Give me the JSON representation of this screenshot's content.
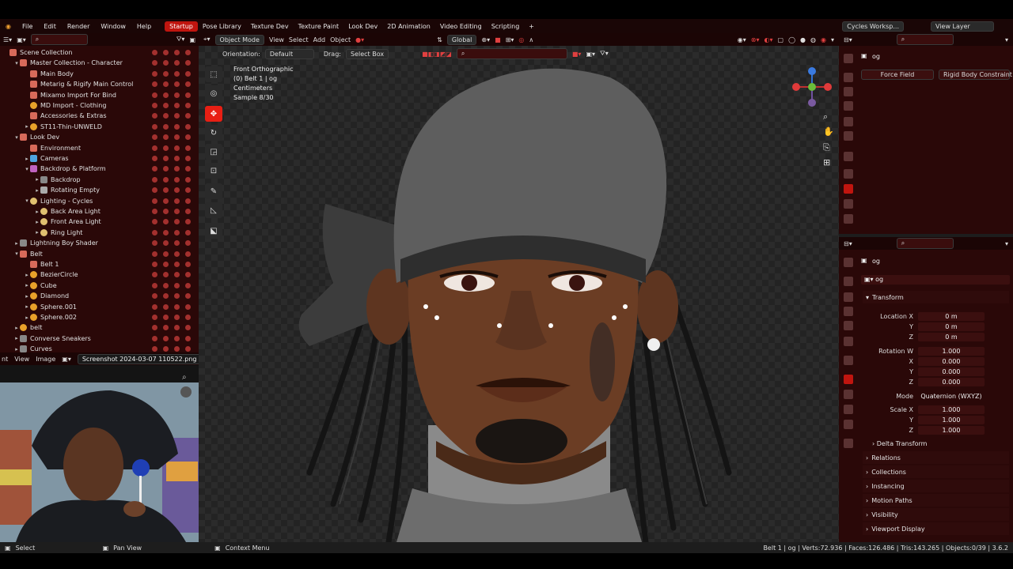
{
  "topbar": {
    "menu": [
      "File",
      "Edit",
      "Render",
      "Window",
      "Help"
    ],
    "workspaces": [
      "Startup",
      "Pose Library",
      "Texture Dev",
      "Texture Paint",
      "Look Dev",
      "2D Animation",
      "Video Editing",
      "Scripting"
    ],
    "add_tab": "+",
    "scene": "Cycles Worksp...",
    "view_layer": "View Layer"
  },
  "outliner": {
    "rows": [
      {
        "label": "Scene Collection",
        "icon": "col",
        "indent": 0,
        "twist": ""
      },
      {
        "label": "Master Collection - Character",
        "icon": "col",
        "indent": 1,
        "twist": "▾"
      },
      {
        "label": "Main Body",
        "icon": "col",
        "indent": 2,
        "twist": ""
      },
      {
        "label": "Metarig & Rigify Main Control",
        "icon": "col",
        "indent": 2,
        "twist": ""
      },
      {
        "label": "Mixamo Import For Bind",
        "icon": "col",
        "indent": 2,
        "twist": ""
      },
      {
        "label": "MD Import - Clothing",
        "icon": "mesh",
        "indent": 2,
        "twist": ""
      },
      {
        "label": "Accessories & Extras",
        "icon": "col",
        "indent": 2,
        "twist": ""
      },
      {
        "label": "ST11-Thin-UNWELD",
        "icon": "mesh",
        "indent": 2,
        "twist": "▸"
      },
      {
        "label": "Look Dev",
        "icon": "col",
        "indent": 1,
        "twist": "▾"
      },
      {
        "label": "Environment",
        "icon": "col",
        "indent": 2,
        "twist": ""
      },
      {
        "label": "Cameras",
        "icon": "cam",
        "indent": 2,
        "twist": "▸"
      },
      {
        "label": "Backdrop & Platform",
        "icon": "cup",
        "indent": 2,
        "twist": "▾"
      },
      {
        "label": "Backdrop",
        "icon": "gray",
        "indent": 3,
        "twist": "▸"
      },
      {
        "label": "Rotating Empty",
        "icon": "emp",
        "indent": 3,
        "twist": "▸"
      },
      {
        "label": "Lighting - Cycles",
        "icon": "light",
        "indent": 2,
        "twist": "▾"
      },
      {
        "label": "Back Area Light",
        "icon": "light",
        "indent": 3,
        "twist": "▸"
      },
      {
        "label": "Front Area Light",
        "icon": "light",
        "indent": 3,
        "twist": "▸"
      },
      {
        "label": "Ring Light",
        "icon": "light",
        "indent": 3,
        "twist": "▸"
      },
      {
        "label": "Lightning Boy Shader",
        "icon": "gray",
        "indent": 1,
        "twist": "▸"
      },
      {
        "label": "Belt",
        "icon": "col",
        "indent": 1,
        "twist": "▾"
      },
      {
        "label": "Belt 1",
        "icon": "col",
        "indent": 2,
        "twist": ""
      },
      {
        "label": "BezierCircle",
        "icon": "mesh",
        "indent": 2,
        "twist": "▸"
      },
      {
        "label": "Cube",
        "icon": "mesh",
        "indent": 2,
        "twist": "▸"
      },
      {
        "label": "Diamond",
        "icon": "mesh",
        "indent": 2,
        "twist": "▸"
      },
      {
        "label": "Sphere.001",
        "icon": "mesh",
        "indent": 2,
        "twist": "▸"
      },
      {
        "label": "Sphere.002",
        "icon": "mesh",
        "indent": 2,
        "twist": "▸"
      },
      {
        "label": "belt",
        "icon": "mesh",
        "indent": 1,
        "twist": "▸"
      },
      {
        "label": "Converse Sneakers",
        "icon": "gray",
        "indent": 1,
        "twist": "▸"
      },
      {
        "label": "Curves",
        "icon": "gray",
        "indent": 1,
        "twist": "▸"
      }
    ]
  },
  "image_editor": {
    "mode": "nt",
    "menu": [
      "View",
      "Image"
    ],
    "image_name": "Screenshot 2024-03-07 110522.png"
  },
  "viewport": {
    "mode": "Object Mode",
    "menu": [
      "View",
      "Select",
      "Add",
      "Object"
    ],
    "transform_orientation": "Global",
    "orientation_label": "Orientation:",
    "orientation_value": "Default",
    "drag_label": "Drag:",
    "drag_value": "Select Box",
    "info": [
      "Front Orthographic",
      "(0) Belt 1 | og",
      "Centimeters",
      "Sample 8/30"
    ]
  },
  "properties_top": {
    "object": "og",
    "buttons": [
      "Force Field",
      "Rigid Body Constraint"
    ]
  },
  "properties": {
    "object": "og",
    "data_name": "og",
    "transform_label": "Transform",
    "fields": [
      {
        "label": "Location X",
        "value": "0 m"
      },
      {
        "label": "Y",
        "value": "0 m"
      },
      {
        "label": "Z",
        "value": "0 m"
      },
      {
        "label": "Rotation W",
        "value": "1.000"
      },
      {
        "label": "X",
        "value": "0.000"
      },
      {
        "label": "Y",
        "value": "0.000"
      },
      {
        "label": "Z",
        "value": "0.000"
      },
      {
        "label": "Mode",
        "value": "Quaternion (WXYZ)"
      },
      {
        "label": "Scale X",
        "value": "1.000"
      },
      {
        "label": "Y",
        "value": "1.000"
      },
      {
        "label": "Z",
        "value": "1.000"
      }
    ],
    "delta_transform": "Delta Transform",
    "sections": [
      "Relations",
      "Collections",
      "Instancing",
      "Motion Paths",
      "Visibility",
      "Viewport Display"
    ]
  },
  "statusbar": {
    "select": "Select",
    "pan": "Pan View",
    "context": "Context Menu",
    "stats": "Belt 1 | og | Verts:72.936 | Faces:126.486 | Tris:143.265 | Objects:0/39 | 3.6.2"
  }
}
